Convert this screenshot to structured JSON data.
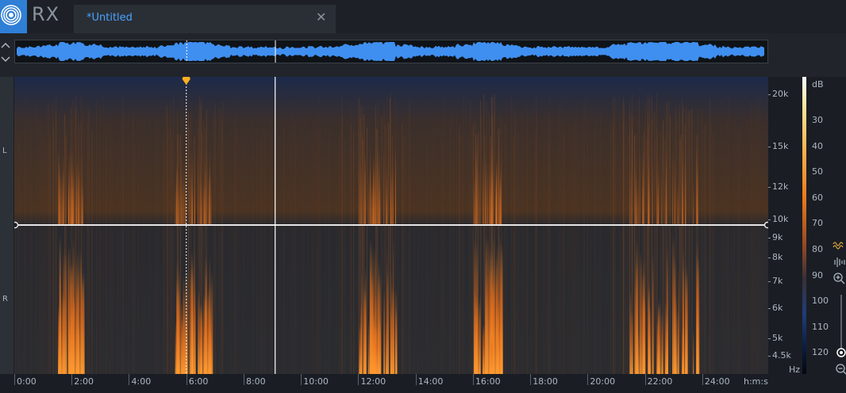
{
  "app": {
    "name": "RX"
  },
  "tab": {
    "title": "*Untitled"
  },
  "icons": {
    "logo": "rx-logo-icon",
    "close": "close-icon",
    "view_toggle": "chevron-up-down-icon",
    "waveform_view": "waveform-view-icon",
    "spectrogram_view": "spectrogram-view-icon",
    "zoom_in": "zoom-in-icon",
    "zoom_out": "zoom-out-icon"
  },
  "channels": [
    "L",
    "R"
  ],
  "freq_axis": {
    "ticks": [
      {
        "label": "20k",
        "value": 20000
      },
      {
        "label": "15k",
        "value": 15000
      },
      {
        "label": "12k",
        "value": 12000
      },
      {
        "label": "10k",
        "value": 10000
      },
      {
        "label": "9k",
        "value": 9000
      },
      {
        "label": "8k",
        "value": 8000
      },
      {
        "label": "7k",
        "value": 7000
      },
      {
        "label": "6k",
        "value": 6000
      },
      {
        "label": "5k",
        "value": 5000
      },
      {
        "label": "4.5k",
        "value": 4500
      }
    ],
    "unit": "Hz"
  },
  "db_scale": {
    "unit": "dB",
    "ticks": [
      "30",
      "40",
      "50",
      "60",
      "70",
      "80",
      "90",
      "100",
      "110",
      "120"
    ]
  },
  "time_axis": {
    "ticks": [
      "0:00",
      "2:00",
      "4:00",
      "6:00",
      "8:00",
      "10:00",
      "12:00",
      "14:00",
      "16:00",
      "18:00",
      "20:00",
      "22:00",
      "24:00"
    ],
    "unit": "h:m:s",
    "end_minutes": 26.3
  },
  "playhead_minutes": 9.1,
  "marker_minutes": 6.0,
  "colors": {
    "accent": "#2f7fd6",
    "waveform": "#3f8ff0",
    "marker": "#ffb020"
  }
}
